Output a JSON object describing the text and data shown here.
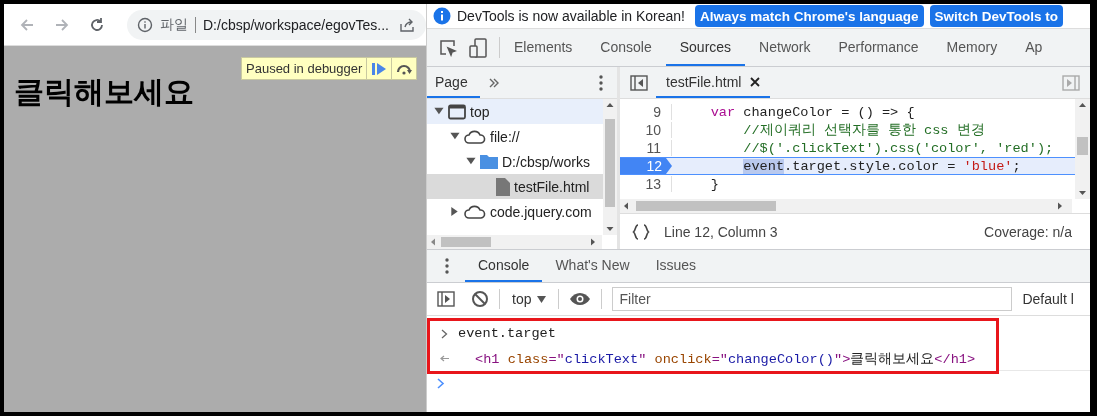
{
  "browser": {
    "nav_buttons": [
      {
        "kind": "back",
        "disabled": true
      },
      {
        "kind": "forward",
        "disabled": true
      },
      {
        "kind": "reload",
        "disabled": false
      }
    ],
    "address": {
      "scheme": "파일",
      "url": "D:/cbsp/workspace/egovTes..."
    },
    "page": {
      "heading": "클릭해보세요"
    },
    "paused_overlay": {
      "label": "Paused in debugger"
    }
  },
  "devtools": {
    "infobar": {
      "message": "DevTools is now available in Korean!",
      "buttons": [
        "Always match Chrome's language",
        "Switch DevTools to"
      ]
    },
    "tabs": [
      {
        "label": "Elements",
        "selected": false
      },
      {
        "label": "Console",
        "selected": false
      },
      {
        "label": "Sources",
        "selected": true
      },
      {
        "label": "Network",
        "selected": false
      },
      {
        "label": "Performance",
        "selected": false
      },
      {
        "label": "Memory",
        "selected": false
      },
      {
        "label": "Ap",
        "selected": false
      }
    ],
    "navigator": {
      "tabs": [
        {
          "label": "Page",
          "selected": true
        }
      ],
      "tree": [
        {
          "label": "top",
          "kind": "frame",
          "expanded": true,
          "selected": false,
          "hovered": true,
          "children": [
            {
              "label": "file://",
              "kind": "origin",
              "expanded": true,
              "selected": false,
              "hovered": false,
              "children": [
                {
                  "label": "D:/cbsp/works",
                  "kind": "folder",
                  "expanded": true,
                  "selected": false,
                  "hovered": false,
                  "children": [
                    {
                      "label": "testFile.html",
                      "kind": "file",
                      "selected": true,
                      "hovered": false
                    }
                  ]
                }
              ]
            },
            {
              "label": "code.jquery.com",
              "kind": "origin",
              "expanded": false,
              "selected": false,
              "hovered": false
            }
          ]
        }
      ]
    },
    "editor": {
      "tabs": [
        {
          "label": "testFile.html",
          "selected": true
        }
      ],
      "lines": [
        {
          "number": "9",
          "current": false,
          "tokens": [
            {
              "text": "    var",
              "kind": "keyword"
            },
            {
              "text": " changeColor = () => {",
              "kind": "plain"
            }
          ]
        },
        {
          "number": "10",
          "current": false,
          "tokens": [
            {
              "text": "        //제이쿼리 선택자를 통한 css 변경",
              "kind": "comment"
            }
          ]
        },
        {
          "number": "11",
          "current": false,
          "tokens": [
            {
              "text": "        //$('.clickText').css('color', 'red');",
              "kind": "comment"
            }
          ]
        },
        {
          "number": "12",
          "current": true,
          "tokens": [
            {
              "text": "        event",
              "kind": "match"
            },
            {
              "text": ".target.style.color = ",
              "kind": "plain"
            },
            {
              "text": "'blue'",
              "kind": "string"
            },
            {
              "text": ";",
              "kind": "plain"
            }
          ]
        },
        {
          "number": "13",
          "current": false,
          "tokens": [
            {
              "text": "    }",
              "kind": "plain"
            }
          ]
        }
      ],
      "status": {
        "position": "Line 12, Column 3",
        "coverage": "Coverage: n/a"
      }
    },
    "drawer": {
      "tabs": [
        {
          "label": "Console",
          "selected": true
        },
        {
          "label": "What's New",
          "selected": false
        },
        {
          "label": "Issues",
          "selected": false
        }
      ],
      "toolbar": {
        "context": "top",
        "filter_placeholder": "Filter",
        "levels": "Default l"
      },
      "messages": [
        {
          "kind": "input",
          "tokens": [
            {
              "text": "event.target",
              "kind": "plain"
            }
          ]
        },
        {
          "kind": "result",
          "tokens": [
            {
              "text": "<h1",
              "kind": "tag"
            },
            {
              "text": " class",
              "kind": "attr"
            },
            {
              "text": "=\"",
              "kind": "tag"
            },
            {
              "text": "clickText",
              "kind": "value"
            },
            {
              "text": "\"",
              "kind": "tag"
            },
            {
              "text": " onclick",
              "kind": "attr"
            },
            {
              "text": "=\"",
              "kind": "tag"
            },
            {
              "text": "changeColor()",
              "kind": "value"
            },
            {
              "text": "\">",
              "kind": "tag"
            },
            {
              "text": "클릭해보세요",
              "kind": "plain"
            },
            {
              "text": "</h1>",
              "kind": "tag"
            }
          ]
        }
      ]
    }
  }
}
